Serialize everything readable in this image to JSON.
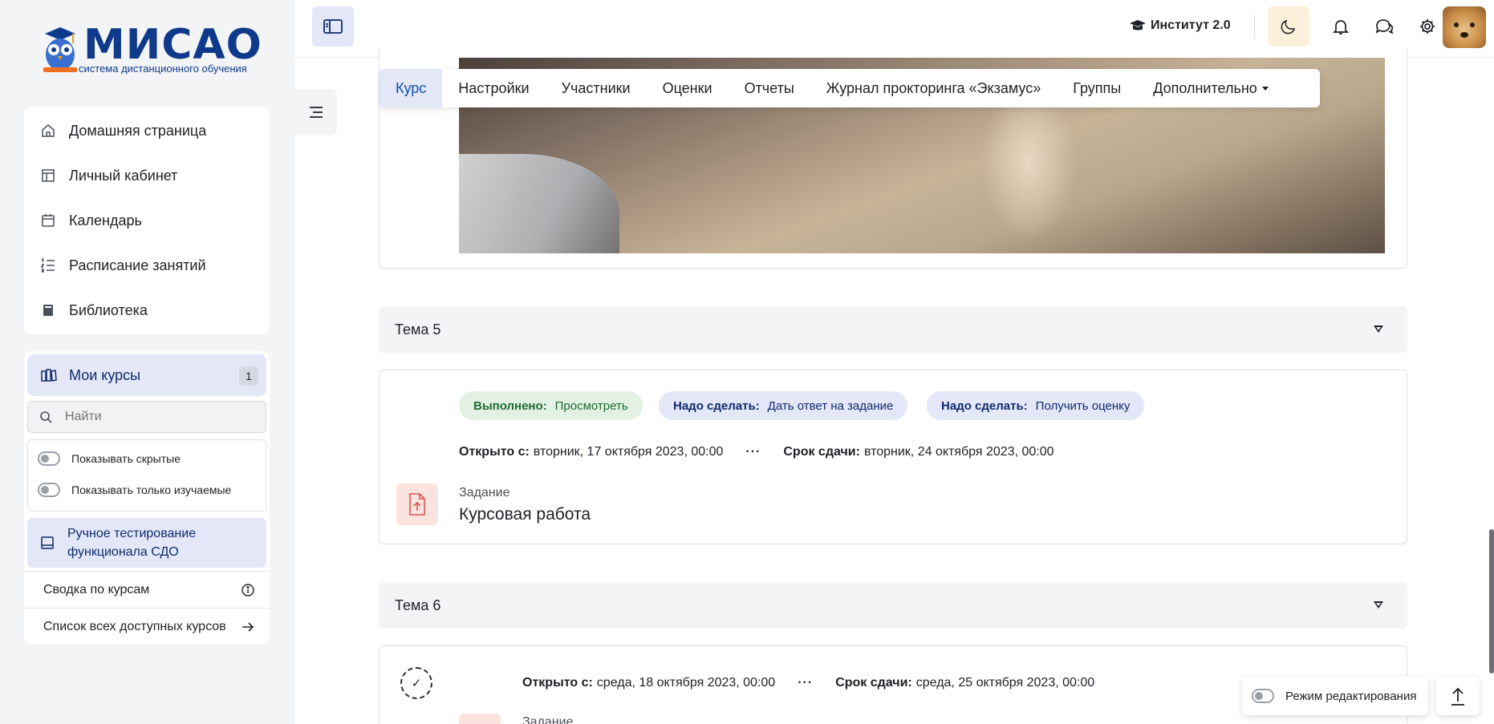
{
  "brand": {
    "name": "МИСАО",
    "tagline": "система дистанционного обучения"
  },
  "nav": {
    "items": [
      {
        "label": "Домашняя страница",
        "icon": "home-icon"
      },
      {
        "label": "Личный кабинет",
        "icon": "dashboard-icon"
      },
      {
        "label": "Календарь",
        "icon": "calendar-icon"
      },
      {
        "label": "Расписание занятий",
        "icon": "list-ordered-icon"
      },
      {
        "label": "Библиотека",
        "icon": "book-icon"
      }
    ]
  },
  "courses": {
    "title": "Мои курсы",
    "count": "1",
    "search_placeholder": "Найти",
    "show_hidden": "Показывать скрытые",
    "show_studied": "Показывать только изучаемые",
    "course_name": "Ручное тестирование функционала СДО",
    "summary_link": "Сводка по курсам",
    "all_courses_link": "Список всех доступных курсов"
  },
  "topbar": {
    "institute": "Институт 2.0"
  },
  "tabs": [
    {
      "label": "Курс",
      "active": true
    },
    {
      "label": "Настройки"
    },
    {
      "label": "Участники"
    },
    {
      "label": "Оценки"
    },
    {
      "label": "Отчеты"
    },
    {
      "label": "Журнал прокторинга «Экзамус»"
    },
    {
      "label": "Группы"
    },
    {
      "label": "Дополнительно",
      "dropdown": true
    }
  ],
  "sections": [
    {
      "title": "Тема 5",
      "completion": [
        {
          "status": "Выполнено:",
          "text": "Просмотреть",
          "kind": "done"
        },
        {
          "status": "Надо сделать:",
          "text": "Дать ответ на задание",
          "kind": "todo"
        },
        {
          "status": "Надо сделать:",
          "text": "Получить оценку",
          "kind": "todo"
        }
      ],
      "opened_label": "Открыто с:",
      "opened_value": "вторник, 17 октября 2023, 00:00",
      "due_label": "Срок сдачи:",
      "due_value": "вторник, 24 октября 2023, 00:00",
      "activity_type": "Задание",
      "activity_name": "Курсовая работа"
    },
    {
      "title": "Тема 6",
      "opened_label": "Открыто с:",
      "opened_value": "среда, 18 октября 2023, 00:00",
      "due_label": "Срок сдачи:",
      "due_value": "среда, 25 октября 2023, 00:00",
      "activity_type": "Задание"
    }
  ],
  "footer": {
    "edit_mode": "Режим редактирования"
  },
  "colors": {
    "brand": "#0f3a8c",
    "active_bg": "#e3e7f7",
    "done_bg": "#e2f1e4",
    "assign_icon_bg": "#fbe4e0"
  }
}
